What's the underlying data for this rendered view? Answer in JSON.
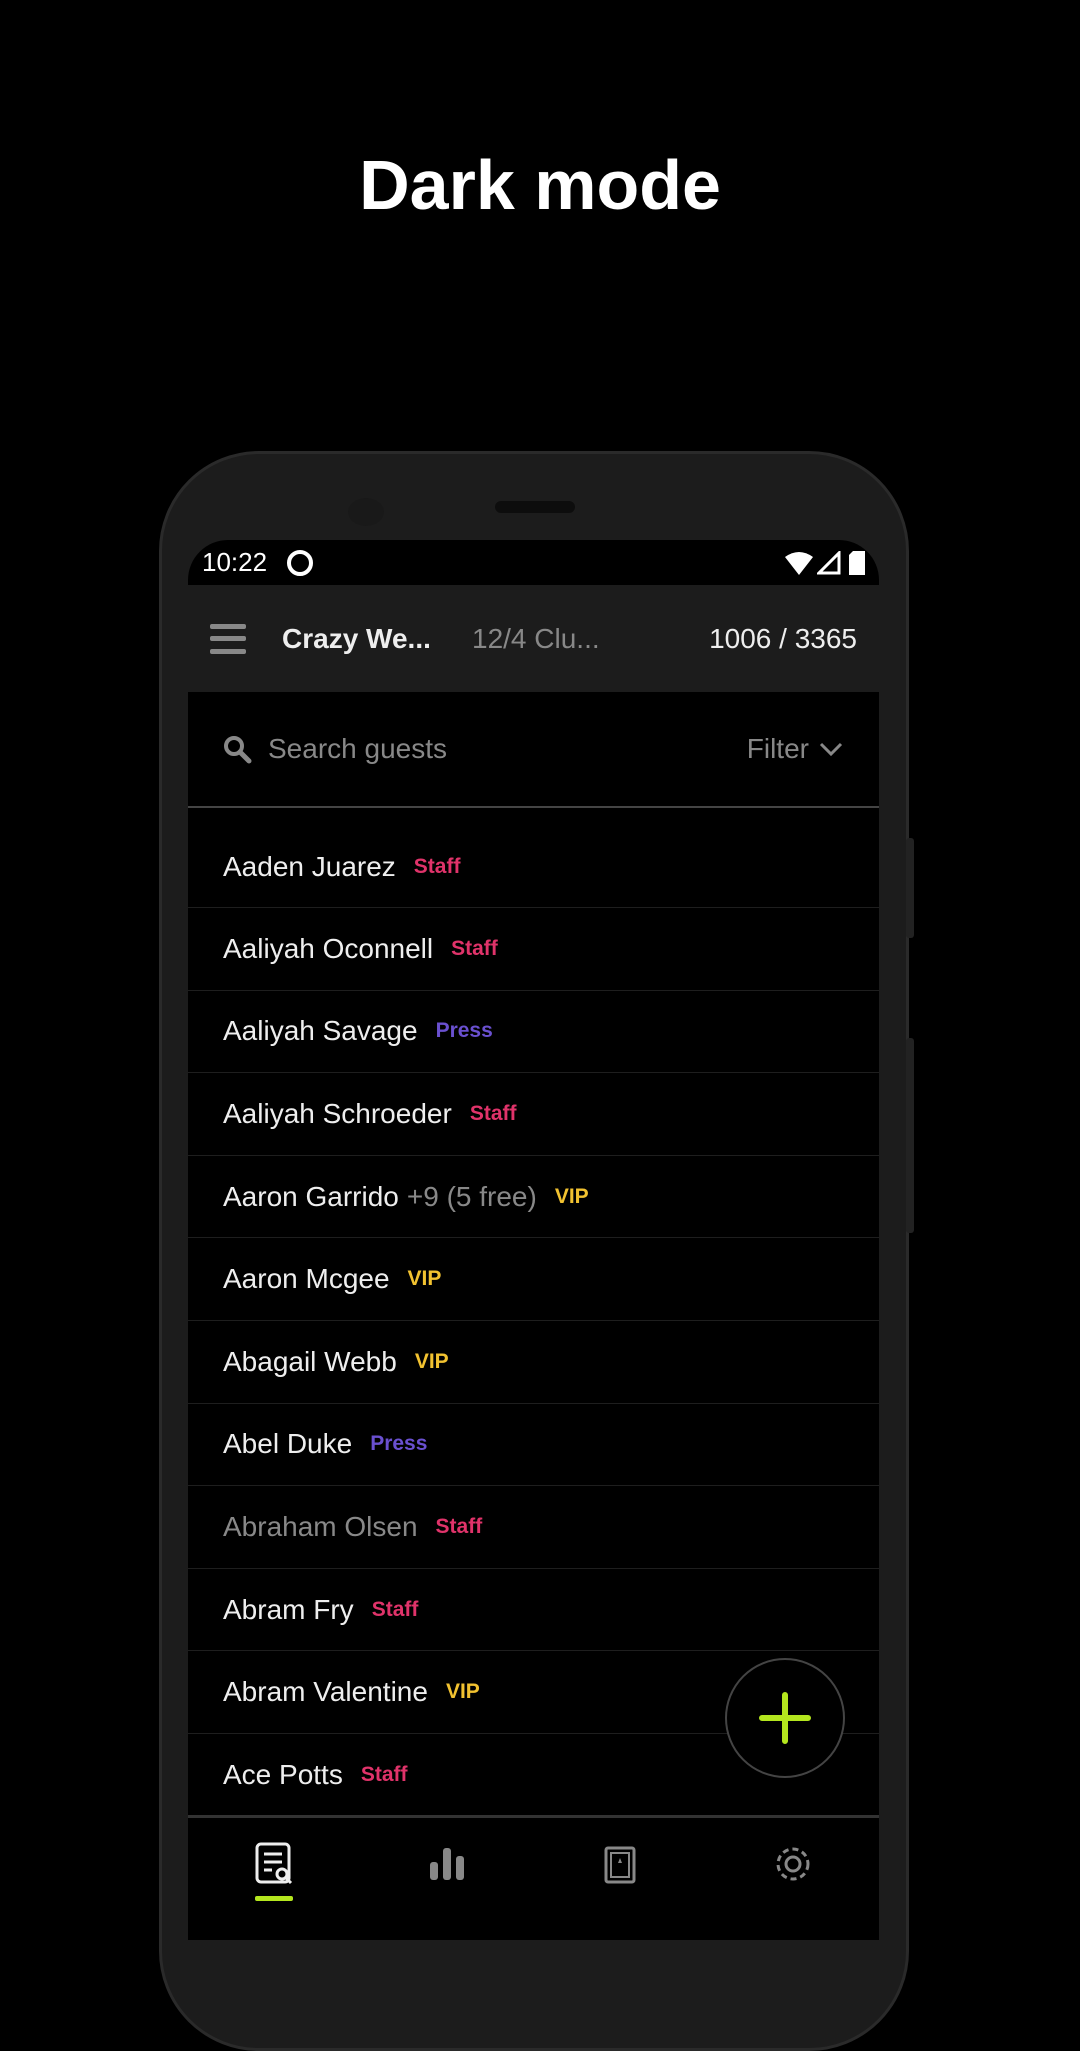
{
  "headline": "Dark mode",
  "status": {
    "time": "10:22"
  },
  "appbar": {
    "title": "Crazy We...",
    "subtitle": "12/4  Clu...",
    "count": "1006 / 3365"
  },
  "search": {
    "placeholder": "Search guests",
    "filter_label": "Filter"
  },
  "colors": {
    "staff": "#e0336a",
    "press": "#6a50d0",
    "vip": "#f2c230",
    "accent": "#b4e61e"
  },
  "guests": [
    {
      "name": "Aaden Juarez",
      "tag": "Staff",
      "extra": ""
    },
    {
      "name": "Aaliyah Oconnell",
      "tag": "Staff",
      "extra": ""
    },
    {
      "name": "Aaliyah Savage",
      "tag": "Press",
      "extra": ""
    },
    {
      "name": "Aaliyah Schroeder",
      "tag": "Staff",
      "extra": ""
    },
    {
      "name": "Aaron Garrido",
      "tag": "VIP",
      "extra": "+9 (5 free)"
    },
    {
      "name": "Aaron Mcgee",
      "tag": "VIP",
      "extra": ""
    },
    {
      "name": "Abagail Webb",
      "tag": "VIP",
      "extra": ""
    },
    {
      "name": "Abel Duke",
      "tag": "Press",
      "extra": ""
    },
    {
      "name": "Abraham Olsen",
      "tag": "Staff",
      "extra": "",
      "dimmed": true
    },
    {
      "name": "Abram Fry",
      "tag": "Staff",
      "extra": ""
    },
    {
      "name": "Abram Valentine",
      "tag": "VIP",
      "extra": ""
    },
    {
      "name": "Ace Potts",
      "tag": "Staff",
      "extra": ""
    }
  ],
  "nav": [
    {
      "icon": "guest-list-icon",
      "active": true
    },
    {
      "icon": "stats-icon"
    },
    {
      "icon": "ticket-icon"
    },
    {
      "icon": "settings-icon"
    }
  ]
}
